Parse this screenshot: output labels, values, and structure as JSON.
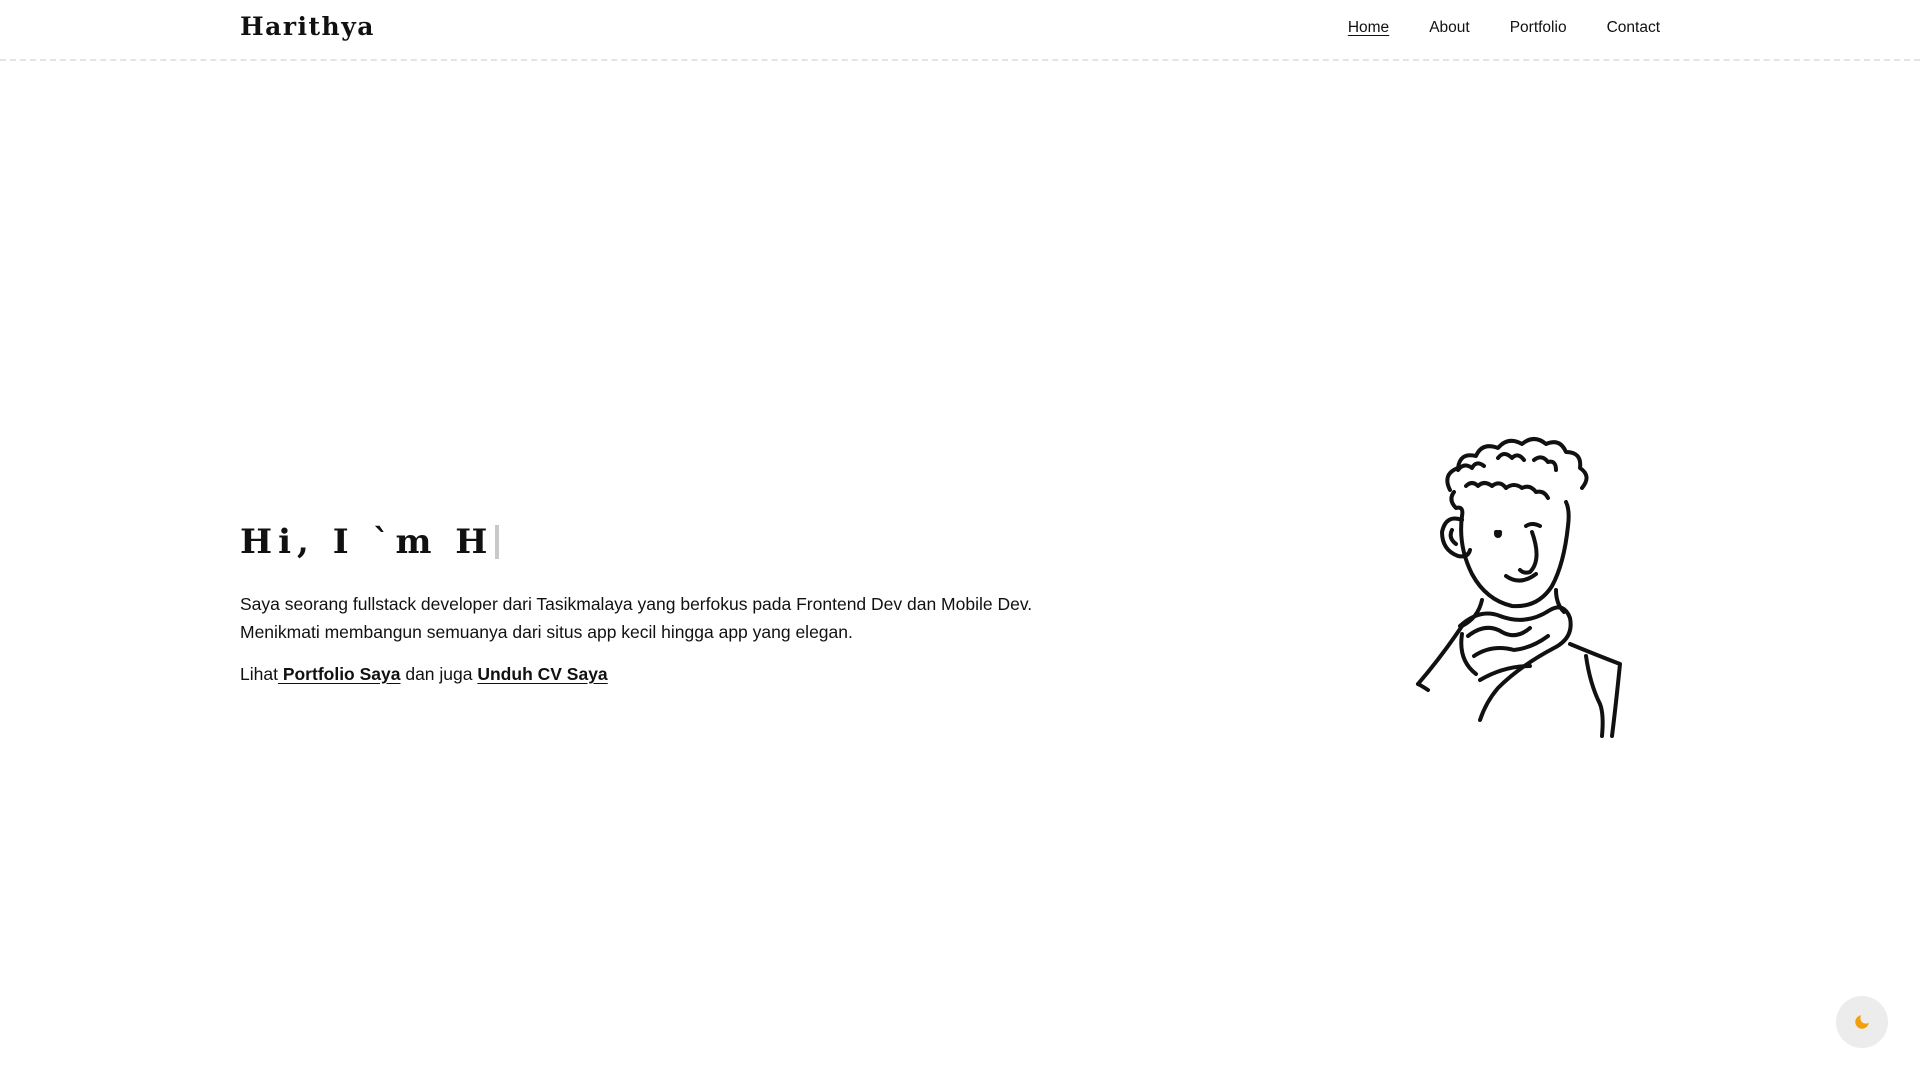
{
  "brand": "Harithya",
  "nav": {
    "items": [
      {
        "label": "Home",
        "active": true
      },
      {
        "label": "About",
        "active": false
      },
      {
        "label": "Portfolio",
        "active": false
      },
      {
        "label": "Contact",
        "active": false
      }
    ]
  },
  "hero": {
    "title_typed": "Hi, I `m H",
    "description_line1": "Saya seorang fullstack developer dari Tasikmalaya yang berfokus pada Frontend Dev dan Mobile Dev.",
    "description_line2": "Menikmati membangun semuanya dari situs app kecil hingga app yang elegan.",
    "links_prefix": "Lihat",
    "portfolio_link": " Portfolio Saya",
    "links_middle": " dan juga ",
    "cv_link": "Unduh CV Saya"
  },
  "illustration": {
    "icon": "avatar-sketch-icon"
  },
  "theme_toggle": {
    "icon": "moon-icon",
    "color": "#f59e0b"
  }
}
